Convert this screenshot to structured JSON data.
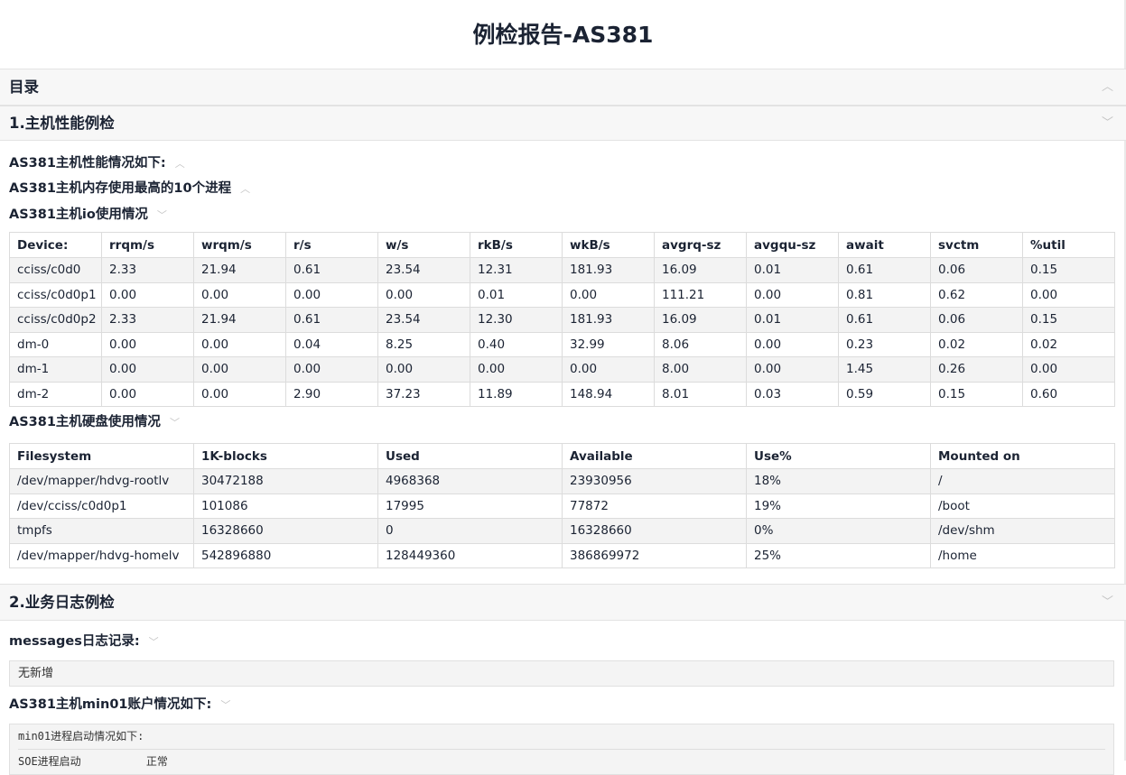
{
  "page": {
    "title": "例检报告-AS381"
  },
  "toc": {
    "label": "目录",
    "chevron_icon": "chevron-up-icon"
  },
  "section1": {
    "title": "1.主机性能例检",
    "chevron_icon": "chevron-down-icon",
    "sub_perf": "AS381主机性能情况如下:",
    "sub_mem": "AS381主机内存使用最高的10个进程",
    "sub_io": "AS381主机io使用情况",
    "io_table": {
      "headers": [
        "Device:",
        "rrqm/s",
        "wrqm/s",
        "r/s",
        "w/s",
        "rkB/s",
        "wkB/s",
        "avgrq-sz",
        "avgqu-sz",
        "await",
        "svctm",
        "%util"
      ],
      "rows": [
        [
          "cciss/c0d0",
          "2.33",
          "21.94",
          "0.61",
          "23.54",
          "12.31",
          "181.93",
          "16.09",
          "0.01",
          "0.61",
          "0.06",
          "0.15"
        ],
        [
          "cciss/c0d0p1",
          "0.00",
          "0.00",
          "0.00",
          "0.00",
          "0.01",
          "0.00",
          "111.21",
          "0.00",
          "0.81",
          "0.62",
          "0.00"
        ],
        [
          "cciss/c0d0p2",
          "2.33",
          "21.94",
          "0.61",
          "23.54",
          "12.30",
          "181.93",
          "16.09",
          "0.01",
          "0.61",
          "0.06",
          "0.15"
        ],
        [
          "dm-0",
          "0.00",
          "0.00",
          "0.04",
          "8.25",
          "0.40",
          "32.99",
          "8.06",
          "0.00",
          "0.23",
          "0.02",
          "0.02"
        ],
        [
          "dm-1",
          "0.00",
          "0.00",
          "0.00",
          "0.00",
          "0.00",
          "0.00",
          "8.00",
          "0.00",
          "1.45",
          "0.26",
          "0.00"
        ],
        [
          "dm-2",
          "0.00",
          "0.00",
          "2.90",
          "37.23",
          "11.89",
          "148.94",
          "8.01",
          "0.03",
          "0.59",
          "0.15",
          "0.60"
        ]
      ]
    },
    "sub_disk": "AS381主机硬盘使用情况",
    "disk_table": {
      "headers": [
        "Filesystem",
        "1K-blocks",
        "Used",
        "Available",
        "Use%",
        "Mounted on"
      ],
      "rows": [
        [
          "/dev/mapper/hdvg-rootlv",
          "30472188",
          "4968368",
          "23930956",
          "18%",
          "/"
        ],
        [
          "/dev/cciss/c0d0p1",
          "101086",
          "17995",
          "77872",
          "19%",
          "/boot"
        ],
        [
          "tmpfs",
          "16328660",
          "0",
          "16328660",
          "0%",
          "/dev/shm"
        ],
        [
          "/dev/mapper/hdvg-homelv",
          "542896880",
          "128449360",
          "386869972",
          "25%",
          "/home"
        ]
      ]
    }
  },
  "section2": {
    "title": "2.业务日志例检",
    "chevron_icon": "chevron-down-icon",
    "sub_messages": "messages日志记录:",
    "messages_content": "无新增",
    "sub_account": "AS381主机min01账户情况如下:",
    "account_lines": [
      "min01进程启动情况如下:",
      "SOE进程启动          正常"
    ]
  }
}
